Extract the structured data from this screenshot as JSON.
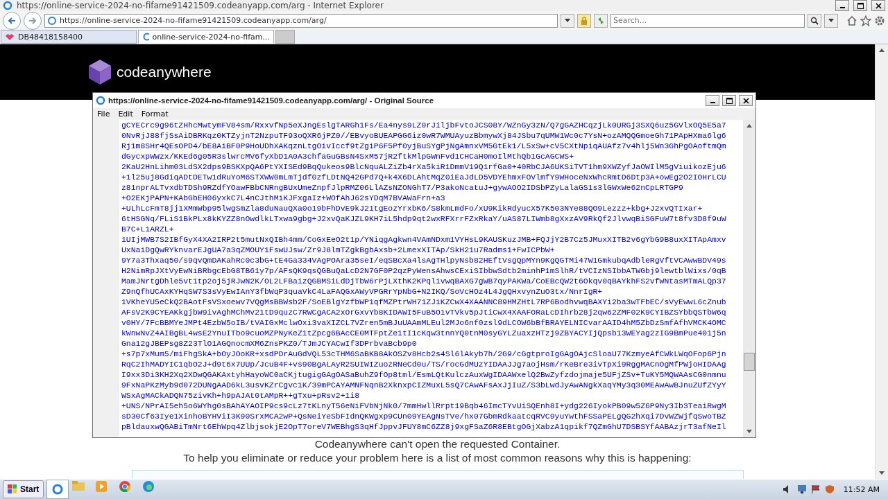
{
  "browser": {
    "title": "https://online-service-2024-no-fifame91421509.codeanyapp.com/arg - Internet Explorer",
    "address": "https://online-service-2024-no-fifame91421509.codeanyapp.com/arg/",
    "search": {
      "placeholder": "Search..."
    },
    "tabs": [
      {
        "label": "DB48418158400",
        "selected": false
      },
      {
        "label": "online-service-2024-no-fifam...",
        "selected": true
      }
    ]
  },
  "page": {
    "logo": "codeanywhere",
    "message": "Codeanywhere can't open the requested Container.",
    "help": "To help you eliminate or reduce your problem here is a list of most common reasons why this is happening:"
  },
  "source_window": {
    "title": "https://online-service-2024-no-fifame91421509.codeanyapp.com/arg/ - Original Source",
    "menu": [
      "File",
      "Edit",
      "Format"
    ],
    "lines": [
      "gCYECrc9g96tZHhcMwtymFV84sm/RxxvfNp5eXJngEslgTARGh1Fs/Ea4nys9LZ0rJiljbFvtoJCS08Y/WZnGy3zN/Q7gGAZHCqzjLk0URGj3SXQ6uz5GVlxOQ5E5a7",
      "0NvRjJ88fjSsAiDBRKqz0KTZyjnT2NzpuTF93oQXR6jPZ0//EBvyoBUEAPGG6iz0wR7WMUAyuzBbmywXj84JSbu7qUMW1Wc0c7YsN+ozAMQQGmoeGh71PApHXma6lg6",
      "Rj1m8SHr4QEsOPD4/bE8AiBF0P9HoUDhXAKqznLtgOivIccf9tZgiP6F5Pf0yjBuSYgPjNgAmnxVM5GtEk1/L5xSw+cV5CXtNpiqAUAfz7v4hlj5Wn3GhPgOAoftmQm",
      "dGycxpWWzx/KKEd6g05R3slwrcMV6fyXbD1A0A3chfaGuGBsN4SxM57jR2ftkMlpGWnFvd1CHCaH0moIlMthQb1GcAGCWS+",
      "2KaU2HnLihm03LdSX2dps9BSKXpQA6PtYXISEd9BqQukeos9BlcNquALZiZb4rXa5kiR1DmmV19Q1rfGa0+40RbCJA6UKSiTVT1hm9XWZyfJaOWIlM5gViuikozEju6",
      "+1l25uj8GdiqADtDETw1dRuYoM6STXWW0mLmTjdf0zfLDtNQ42GPd7Q+k4X6DLAhtMqZ0iEaJdLD5VDYEhmxFOVlmfY9WHoceNxWhcRmtD6Dtp3A+owEg2O2IOHrLCU",
      "z81nprALTvxdbTDSh9RZdfYOawFBbCNRngBUxUmeZnpfJlpRMZ06LlAZsNZONGhT7/P3akoNcatuJ+gywAOO2IDSbPZyLalaGS1s3lGWxWe62nCpLRTGP9",
      "+O2EKjPAPN+KAbGbEH06yxkC7L4nCJthMiKJFxgaIz+WOfAhJ62sYDqM7BVAWaFrn+a3",
      "+ULhLcFmT8jj1XMmWbp95lwgSmZla8duNauQXa0o19bFhDvE9kJ21tgEozYrxbK6/S8kmLmdFo/xU9KikRdyucX57K503NYe88QO9Lezzz+kbg+J2xvQTIxar+",
      "6tHSGNq/FLiS1BkPLx8kKYZZ8nOwdlkLTxwa9gbg+J2xvQaKJZL9KH7iL5hdp9qt2wxRFXrrFZxRkaY/uAS87LIWmb8gXxzAV9RkQf2JlvwqBiSGFuW7t8fv3D8f9uW",
      "B7C+L1ARZL+",
      "1UIjMWB7S2IBfGyX4XA2IRP2t5mutNxQIBh4mm/CoGxEeO2t1p/YNiqgAgkwn4VAmNDxm1VYHsL9KAUSKuzJMB+FQJjY2B7Cz5JMuxXITB2v6gYbG9B8uxXITApAmxv",
      "UxNaiDgQwRYknvarEJgUA7a3qZMOUY1FswUJsw/Zr9J8lmTZgkBgbAxsb+2LmexXITAp/SkH21u7Radms1+FwICPbW+",
      "9Y7a3Thxaq50/s9qvQmDAKahRc0c3bG+tE4Ga334VAgPOAra35seI/eqSBcXa4lsAgTHlpyNsb82HEftVsgQpMYn9KgQGTMi47W1GmkubqAdbleRgVftVCAwwBDV49s",
      "H2NimRpJXtVyEwNiBRbgcEbG8TB61y7p/AFsQK9qsQGBuQaLcD2N7GF0P2qzPyWensAhwsCExiSIbbwSdtb2minhP1mSlhR/tVCIzNSIbbATWGbj9lewtblWixs/0qB",
      "MamJNrtgDhle5vt1tp2oj5jRJwN2K/OL2LFBaizQGBMSiLdDjTbW6rPjLXthK2KPqlivwqBAXG7gWB7qyPAKWa/CoEBcQW2t6Okqv0qBAYkhFS2vfWNtasMTmALQp37",
      "Z9nQfhUCAxKYHqSW7S3sVyEwIAnY3fbWqP3quaVkC4LaFAQGxAWyVPGRrYpNbG+N2IKQ/SoVcHOz4L4JgQHxvynZuO3tx/NnrIgR+",
      "1VKheYU5eCkQ2BAotFsVSxoewv7VQgMsBBWsb2F/SoEBlgYzfbWP1qfMZPtrWH71ZJiKZCwX4XAANNC89HMZHtL7RP6BodhvwqBAXYi2ba3wTFbEC/sVyEwwL6cZnub",
      "AFsV2K9CYEAKkgjbW9ivAghMChMv21tD9quzC7RWCgACA2xOrGxvYb8KIDAWI5FuB5O1vTVkv5pJtiCwX4XAAFORaLcDIhrb28j2qw62ZMF02K9CYIBZSYbbQSTbW6q",
      "v0HY/7FcBBMYeJMPt4EzbW5oIB/tVAIGxMclwOxi3vaXIZCL7VZren5mBJuUAAmMLEul2MJo6nf0zsl9dLCOW6bBfBRAYELNICvarAAID4hM5ZbDzSmfAfhVMCK4OMC",
      "kWnwNvZ4AIBgBL4wsE2YnuITbo9cuoMZPNyKeZ1tZpcg6BAcCE0MTFptZe1tI1cKqw3tnnYQ0tnM0syGYLZuaxzHTzj9ZBYACYIjQpsb13WEYag2zIG9BmPue401j5n",
      "Gna12gJBEPsg8Z23TlO1AGQnocmXM6ZnsPKZ0/TJmJCYACwIf3DPrbvaBcb9p0",
      "+s7p7xMum5/miFhgSkA+bOyJOoKR+xsdPDrAuGdVQL53cTHM6SaBKB8AkOSZv8Hcb2s4Sl6lAkyb7h/2G9/cGgtproIgGAgOAjcSloaU77KzmyeAfCWkLWqOFop6Pjn",
      "RqC2IhMADYIC1qbO2J+d9t6x7UUp/JcuB4F+vs90BgALAyR2SUIWIZuozRNeCd0u/TS/rocGdMUzYIDAAJJg7aojHsm/rKeBre3ivTpXi9RggMACnOgMfPWjoHIDAAg",
      "I9xx3Di3KH2Xq2XDwQGAKAxtyhHayoWC0aCKjtugigGAgOASaBuhZ9fOp8tml/EsmLQtKulczAuxWgIDAAWxelQ2BwZyfzdojmaje5UFjZSv+TuKY5MQWAAsCG0nmnu",
      "9FxNaPKzMyb9d072DUNgAAD6kL3usvKZrCgvc1K/39mPCAYAMNFNqnB2XknxpCIZMuxL5sQ7CAwAFsAxJjIuZ/S3bLwdJyAwANgkXaqYMy3q30MEAwAwBJnuZUfZYyY",
      "WSxAgMACkADQN75zivKh+h9pAJAt0tAMpR++gTxu+pRsv2+1i8",
      "+UNS/NPrAI5eh5o6WYhg0sBAhAYAOIP9cs9cLz7tKLnyT56eNiFVbNjNk0/7mmHwllRrpt19Bqb46ImcTYvUiSQEnh8I+ydg226IyokPB09w5Z6P9Ny3Ib3TeaiRwgM",
      "sD30Cf63Iye1XinhoBYHViI3K90SrxMCA2wP+QsNeiYeSbFIdnQKWgxp9CUn09YEAgNsTVe/hx07GbmRdkaatcqRVC9yuYwthFSSaPELgQG2hXqi7DvWZWjfqSwoTBZ",
      "pBldauxwQGABiTmNrt6EhWpq4ZlbjsokjE2OpT7oreV7WEBhgS3qHfJppvJFUY8mC6ZZ8j9xgFSaZ6R8EBtgOGjXabzA1qpikf7QZmGhU7DSBSYfAABAzjrT3afNeIl"
    ]
  },
  "taskbar": {
    "start": "Start",
    "time": "11:52 AM"
  }
}
